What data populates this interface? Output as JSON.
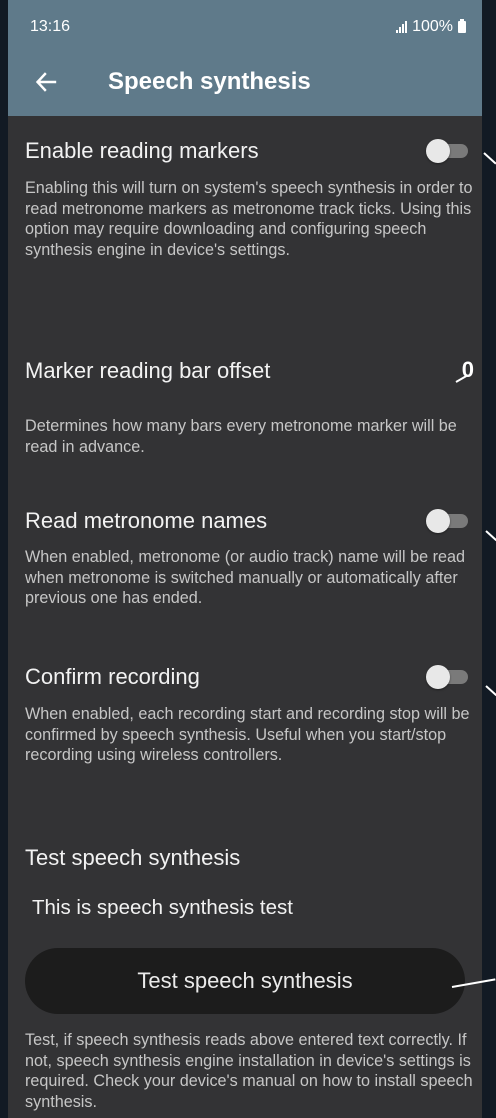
{
  "status_bar": {
    "time": "13:16",
    "battery": "100%"
  },
  "app_bar": {
    "title": "Speech synthesis"
  },
  "settings": [
    {
      "title": "Enable reading markers",
      "description": "Enabling this will turn on system's speech synthesis in order to read metronome markers as metronome track ticks. Using this option may require downloading and configuring speech synthesis engine in device's settings.",
      "enabled": false
    },
    {
      "title": "Marker reading bar offset",
      "value": "0",
      "description": "Determines how many bars every metronome marker will be read in advance."
    },
    {
      "title": "Read metronome names",
      "description": "When enabled, metronome (or audio track) name will be read when metronome is switched manually or automatically after previous one has ended.",
      "enabled": false
    },
    {
      "title": "Confirm recording",
      "description": "When enabled, each recording start and recording stop will be confirmed by speech synthesis. Useful when you start/stop recording using wireless controllers.",
      "enabled": false
    }
  ],
  "test_section": {
    "title": "Test speech synthesis",
    "input_value": "This is speech synthesis test",
    "button_label": "Test speech synthesis",
    "description": "Test, if speech synthesis reads above entered text correctly. If not, speech synthesis engine installation in device's settings is required. Check your device's manual on how to install speech synthesis."
  },
  "colors": {
    "app_bar": "#5f7a8a",
    "background": "#333335",
    "button": "#1c1c1c"
  }
}
